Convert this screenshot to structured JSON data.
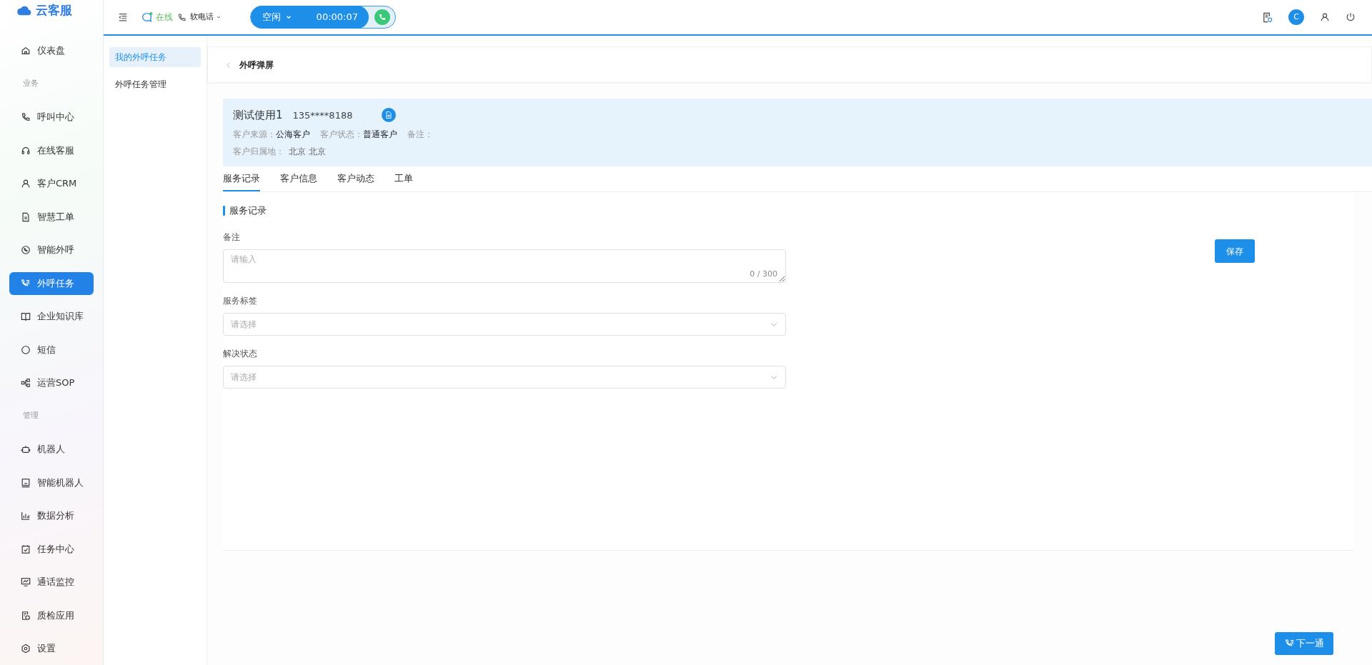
{
  "app": {
    "logo_text": "云客服"
  },
  "topbar": {
    "presence": "在线",
    "phone_mode": "软电话",
    "call_status": "空闲",
    "call_timer": "00:00:07",
    "avatar_letter": "C"
  },
  "sidebar": {
    "items": [
      {
        "kind": "item",
        "label": "仪表盘",
        "selected": false
      },
      {
        "kind": "section",
        "label": "业务"
      },
      {
        "kind": "item",
        "label": "呼叫中心",
        "selected": false
      },
      {
        "kind": "item",
        "label": "在线客服",
        "selected": false
      },
      {
        "kind": "item",
        "label": "客户CRM",
        "selected": false
      },
      {
        "kind": "item",
        "label": "智慧工单",
        "selected": false
      },
      {
        "kind": "item",
        "label": "智能外呼",
        "selected": false
      },
      {
        "kind": "item",
        "label": "外呼任务",
        "selected": true
      },
      {
        "kind": "item",
        "label": "企业知识库",
        "selected": false
      },
      {
        "kind": "item",
        "label": "短信",
        "selected": false
      },
      {
        "kind": "item",
        "label": "运营SOP",
        "selected": false
      },
      {
        "kind": "section",
        "label": "管理"
      },
      {
        "kind": "item",
        "label": "机器人",
        "selected": false
      },
      {
        "kind": "item",
        "label": "智能机器人",
        "selected": false
      },
      {
        "kind": "item",
        "label": "数据分析",
        "selected": false
      },
      {
        "kind": "item",
        "label": "任务中心",
        "selected": false
      },
      {
        "kind": "item",
        "label": "通话监控",
        "selected": false
      },
      {
        "kind": "item",
        "label": "质检应用",
        "selected": false
      },
      {
        "kind": "item",
        "label": "设置",
        "selected": false
      }
    ]
  },
  "subnav": {
    "items": [
      {
        "label": "我的外呼任务",
        "selected": true
      },
      {
        "label": "外呼任务管理",
        "selected": false
      }
    ]
  },
  "page_title": "外呼弹屏",
  "customer": {
    "name": "测试使用1",
    "phone": "135****8188",
    "rows": [
      [
        {
          "label": "客户来源：",
          "value": "公海客户"
        },
        {
          "label": "客户状态：",
          "value": "普通客户"
        },
        {
          "label": "备注："
        }
      ],
      [
        {
          "label": "客户归属地：",
          "value": "北京 北京",
          "muted": true
        }
      ]
    ]
  },
  "tabs": [
    {
      "label": "服务记录",
      "selected": true
    },
    {
      "label": "客户信息",
      "selected": false
    },
    {
      "label": "客户动态",
      "selected": false
    },
    {
      "label": "工单",
      "selected": false
    }
  ],
  "form": {
    "section_title": "服务记录",
    "fields": [
      {
        "kind": "textarea",
        "label": "备注",
        "placeholder": "请输入",
        "counter": "0 / 300"
      },
      {
        "kind": "select",
        "label": "服务标签",
        "placeholder": "请选择"
      },
      {
        "kind": "select",
        "label": "解决状态",
        "placeholder": "请选择"
      }
    ]
  },
  "save_button": "保存",
  "next_button": "下一通"
}
